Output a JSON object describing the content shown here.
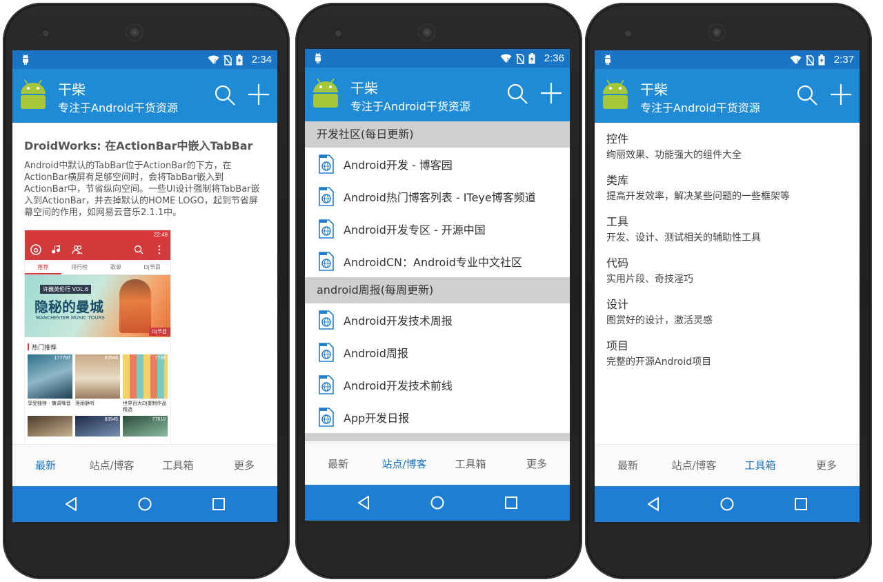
{
  "app": {
    "title": "干柴",
    "subtitle": "专注于Android干货资源"
  },
  "colors": {
    "status_bar": "#1a75c6",
    "app_bar": "#1f8ad6",
    "nav_bar": "#1f7dd3",
    "tab_active": "#1a75c6",
    "tab_inactive": "#666666",
    "section_header": "#cfcfcf"
  },
  "tabs": [
    "最新",
    "站点/博客",
    "工具箱",
    "更多"
  ],
  "screens": [
    {
      "time": "2:34",
      "active_tab": 0,
      "article": {
        "title": "DroidWorks: 在ActionBar中嵌入TabBar",
        "body": "Android中默认的TabBar位于ActionBar的下方，在ActionBar横屏有足够空间时，会将TabBar嵌入到ActionBar中，节省纵向空间。一些UI设计强制将TabBar嵌入到ActionBar，并去掉默认的HOME LOGO，起到节省屏幕空间的作用，如网易云音乐2.1.1中。"
      },
      "embedded_screenshot": {
        "status_time": "22:48",
        "tabs": [
          "推荐",
          "排行榜",
          "歌单",
          "DJ节目"
        ],
        "banner_badge": "许巍英伦行 VOL.6",
        "banner_title": "隐秘的曼城",
        "banner_sub": "MANCHESTER MUSIC TOURS",
        "banner_tag": "DJ节目",
        "section": "热门推荐",
        "cards": [
          {
            "count": "177797",
            "caption": "享受独特 · 慵调嗓音"
          },
          {
            "count": "69546",
            "caption": "落雨静听"
          },
          {
            "count": "7738",
            "caption": "世界百大DJ重制作品精选"
          }
        ],
        "row2_counts": [
          "",
          "83545",
          "77610"
        ]
      }
    },
    {
      "time": "2:36",
      "active_tab": 1,
      "sections": [
        {
          "header": "开发社区(每日更新)",
          "links": [
            "Android开发 - 博客园",
            "Android热门博客列表 - ITeye博客频道",
            "Android开发专区 - 开源中国",
            "AndroidCN：Android专业中文社区"
          ]
        },
        {
          "header": "android周报(每周更新)",
          "links": [
            "Android开发技术周报",
            "Android周报",
            "Android开发技术前线",
            "App开发日报"
          ]
        }
      ]
    },
    {
      "time": "2:37",
      "active_tab": 2,
      "tools": [
        {
          "name": "控件",
          "desc": "绚丽效果、功能强大的组件大全"
        },
        {
          "name": "类库",
          "desc": "提高开发效率，解决某些问题的一些框架等"
        },
        {
          "name": "工具",
          "desc": "开发、设计、测试相关的辅助性工具"
        },
        {
          "name": "代码",
          "desc": "实用片段、奇技淫巧"
        },
        {
          "name": "设计",
          "desc": "图赏好的设计，激活灵感"
        },
        {
          "name": "项目",
          "desc": "完整的开源Android项目"
        }
      ]
    }
  ]
}
